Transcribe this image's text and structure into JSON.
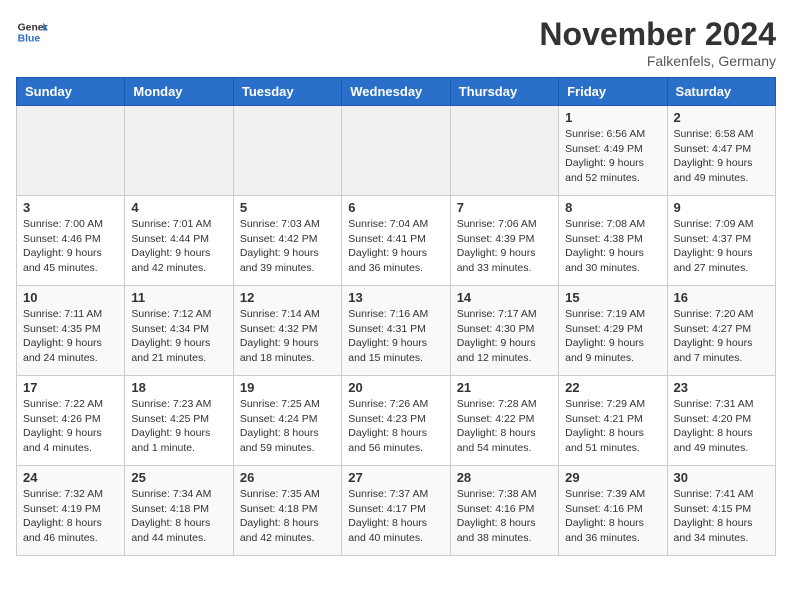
{
  "header": {
    "logo_general": "General",
    "logo_blue": "Blue",
    "month_title": "November 2024",
    "location": "Falkenfels, Germany"
  },
  "days_of_week": [
    "Sunday",
    "Monday",
    "Tuesday",
    "Wednesday",
    "Thursday",
    "Friday",
    "Saturday"
  ],
  "weeks": [
    [
      {
        "day": "",
        "info": ""
      },
      {
        "day": "",
        "info": ""
      },
      {
        "day": "",
        "info": ""
      },
      {
        "day": "",
        "info": ""
      },
      {
        "day": "",
        "info": ""
      },
      {
        "day": "1",
        "info": "Sunrise: 6:56 AM\nSunset: 4:49 PM\nDaylight: 9 hours and 52 minutes."
      },
      {
        "day": "2",
        "info": "Sunrise: 6:58 AM\nSunset: 4:47 PM\nDaylight: 9 hours and 49 minutes."
      }
    ],
    [
      {
        "day": "3",
        "info": "Sunrise: 7:00 AM\nSunset: 4:46 PM\nDaylight: 9 hours and 45 minutes."
      },
      {
        "day": "4",
        "info": "Sunrise: 7:01 AM\nSunset: 4:44 PM\nDaylight: 9 hours and 42 minutes."
      },
      {
        "day": "5",
        "info": "Sunrise: 7:03 AM\nSunset: 4:42 PM\nDaylight: 9 hours and 39 minutes."
      },
      {
        "day": "6",
        "info": "Sunrise: 7:04 AM\nSunset: 4:41 PM\nDaylight: 9 hours and 36 minutes."
      },
      {
        "day": "7",
        "info": "Sunrise: 7:06 AM\nSunset: 4:39 PM\nDaylight: 9 hours and 33 minutes."
      },
      {
        "day": "8",
        "info": "Sunrise: 7:08 AM\nSunset: 4:38 PM\nDaylight: 9 hours and 30 minutes."
      },
      {
        "day": "9",
        "info": "Sunrise: 7:09 AM\nSunset: 4:37 PM\nDaylight: 9 hours and 27 minutes."
      }
    ],
    [
      {
        "day": "10",
        "info": "Sunrise: 7:11 AM\nSunset: 4:35 PM\nDaylight: 9 hours and 24 minutes."
      },
      {
        "day": "11",
        "info": "Sunrise: 7:12 AM\nSunset: 4:34 PM\nDaylight: 9 hours and 21 minutes."
      },
      {
        "day": "12",
        "info": "Sunrise: 7:14 AM\nSunset: 4:32 PM\nDaylight: 9 hours and 18 minutes."
      },
      {
        "day": "13",
        "info": "Sunrise: 7:16 AM\nSunset: 4:31 PM\nDaylight: 9 hours and 15 minutes."
      },
      {
        "day": "14",
        "info": "Sunrise: 7:17 AM\nSunset: 4:30 PM\nDaylight: 9 hours and 12 minutes."
      },
      {
        "day": "15",
        "info": "Sunrise: 7:19 AM\nSunset: 4:29 PM\nDaylight: 9 hours and 9 minutes."
      },
      {
        "day": "16",
        "info": "Sunrise: 7:20 AM\nSunset: 4:27 PM\nDaylight: 9 hours and 7 minutes."
      }
    ],
    [
      {
        "day": "17",
        "info": "Sunrise: 7:22 AM\nSunset: 4:26 PM\nDaylight: 9 hours and 4 minutes."
      },
      {
        "day": "18",
        "info": "Sunrise: 7:23 AM\nSunset: 4:25 PM\nDaylight: 9 hours and 1 minute."
      },
      {
        "day": "19",
        "info": "Sunrise: 7:25 AM\nSunset: 4:24 PM\nDaylight: 8 hours and 59 minutes."
      },
      {
        "day": "20",
        "info": "Sunrise: 7:26 AM\nSunset: 4:23 PM\nDaylight: 8 hours and 56 minutes."
      },
      {
        "day": "21",
        "info": "Sunrise: 7:28 AM\nSunset: 4:22 PM\nDaylight: 8 hours and 54 minutes."
      },
      {
        "day": "22",
        "info": "Sunrise: 7:29 AM\nSunset: 4:21 PM\nDaylight: 8 hours and 51 minutes."
      },
      {
        "day": "23",
        "info": "Sunrise: 7:31 AM\nSunset: 4:20 PM\nDaylight: 8 hours and 49 minutes."
      }
    ],
    [
      {
        "day": "24",
        "info": "Sunrise: 7:32 AM\nSunset: 4:19 PM\nDaylight: 8 hours and 46 minutes."
      },
      {
        "day": "25",
        "info": "Sunrise: 7:34 AM\nSunset: 4:18 PM\nDaylight: 8 hours and 44 minutes."
      },
      {
        "day": "26",
        "info": "Sunrise: 7:35 AM\nSunset: 4:18 PM\nDaylight: 8 hours and 42 minutes."
      },
      {
        "day": "27",
        "info": "Sunrise: 7:37 AM\nSunset: 4:17 PM\nDaylight: 8 hours and 40 minutes."
      },
      {
        "day": "28",
        "info": "Sunrise: 7:38 AM\nSunset: 4:16 PM\nDaylight: 8 hours and 38 minutes."
      },
      {
        "day": "29",
        "info": "Sunrise: 7:39 AM\nSunset: 4:16 PM\nDaylight: 8 hours and 36 minutes."
      },
      {
        "day": "30",
        "info": "Sunrise: 7:41 AM\nSunset: 4:15 PM\nDaylight: 8 hours and 34 minutes."
      }
    ]
  ]
}
